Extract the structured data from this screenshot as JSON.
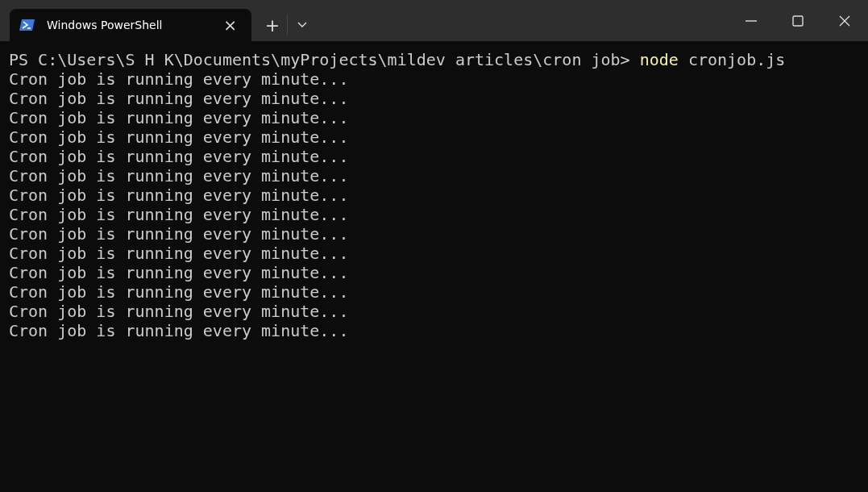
{
  "tabs": [
    {
      "title": "Windows PowerShell",
      "close": "×",
      "selected": true
    }
  ],
  "new_tab": "+",
  "prompt_line": {
    "prompt": "PS C:\\Users\\S H K\\Documents\\myProjects\\mildev articles\\cron job>",
    "command": "node",
    "args": "cronjob.js"
  },
  "output_lines": [
    "Cron job is running every minute...",
    "Cron job is running every minute...",
    "Cron job is running every minute...",
    "Cron job is running every minute...",
    "Cron job is running every minute...",
    "Cron job is running every minute...",
    "Cron job is running every minute...",
    "Cron job is running every minute...",
    "Cron job is running every minute...",
    "Cron job is running every minute...",
    "Cron job is running every minute...",
    "Cron job is running every minute...",
    "Cron job is running every minute...",
    "Cron job is running every minute..."
  ]
}
